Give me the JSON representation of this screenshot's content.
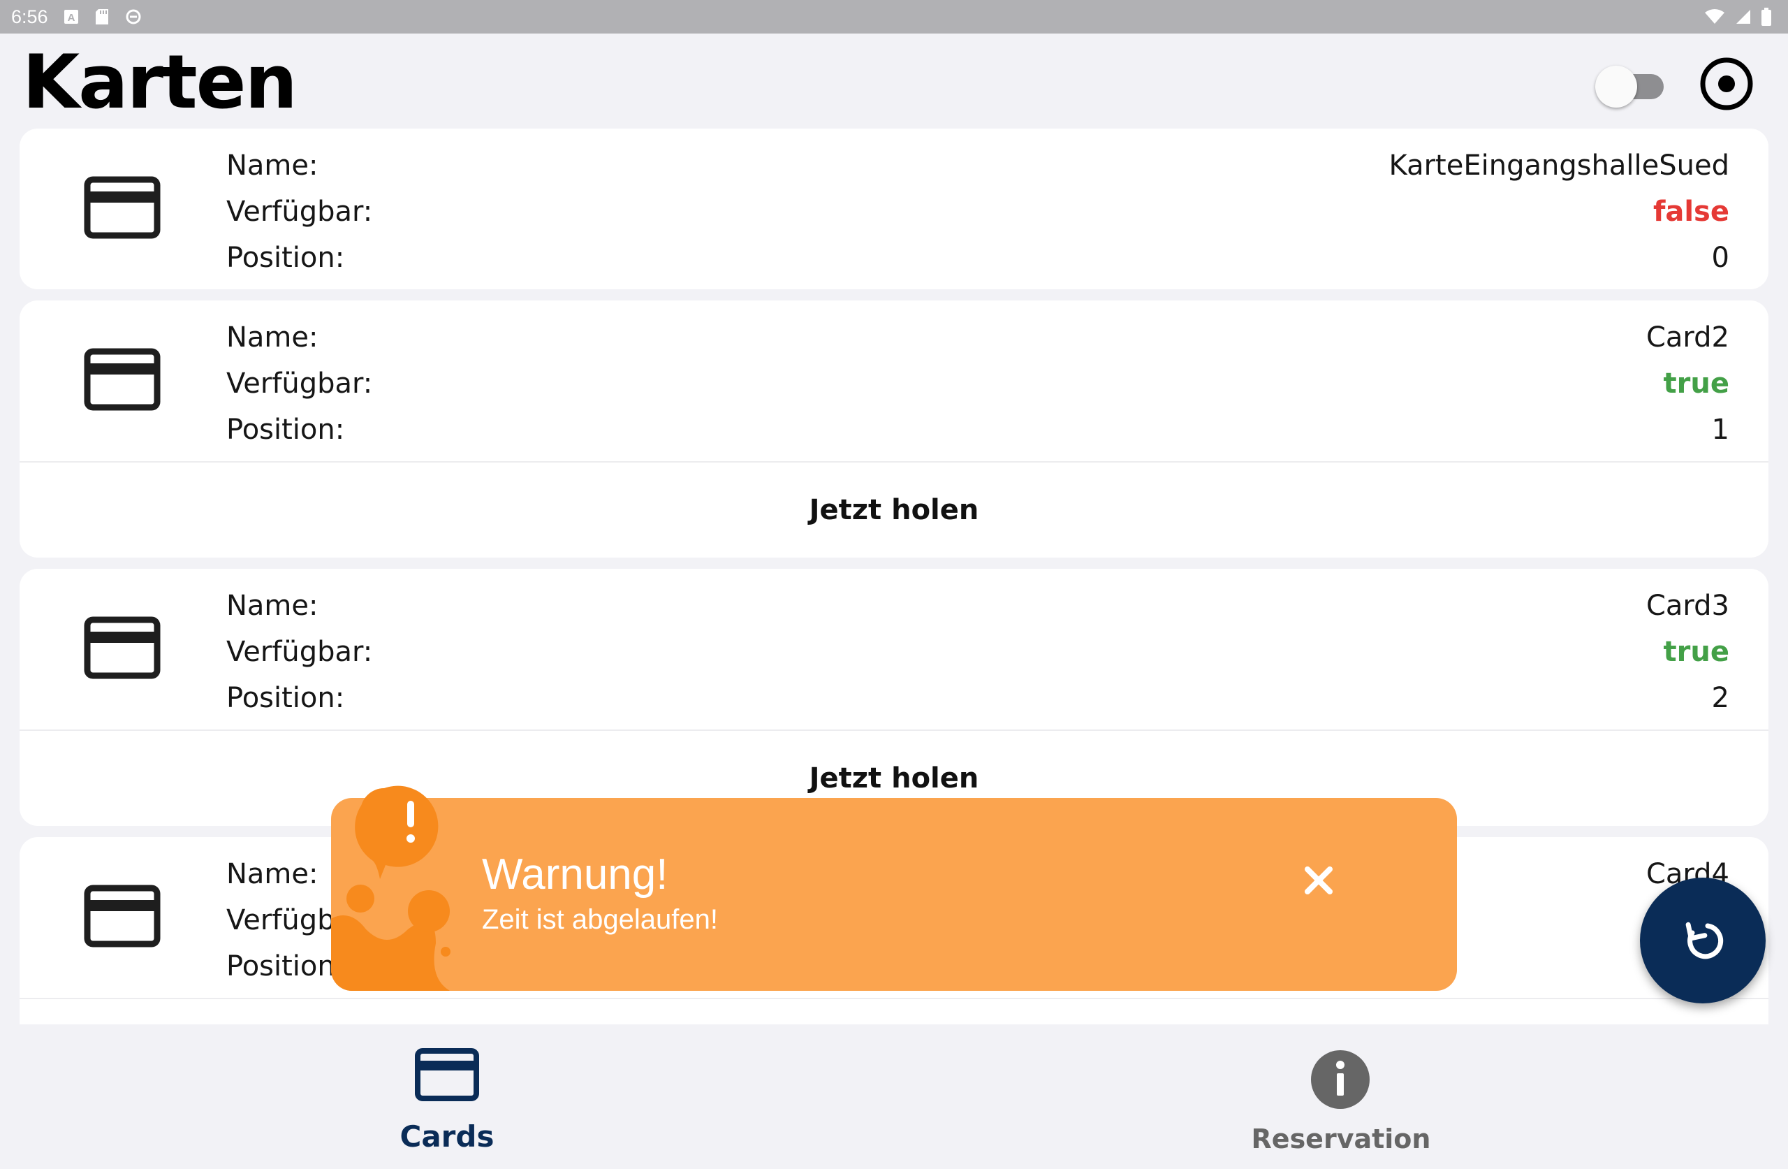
{
  "status_bar": {
    "time": "6:56"
  },
  "header": {
    "title": "Karten"
  },
  "cards": [
    {
      "name_label": "Name:",
      "name": "KarteEingangshalleSued",
      "available_label": "Verfügbar:",
      "available": "false",
      "position_label": "Position:",
      "position": "0",
      "action_label": null
    },
    {
      "name_label": "Name:",
      "name": "Card2",
      "available_label": "Verfügbar:",
      "available": "true",
      "position_label": "Position:",
      "position": "1",
      "action_label": "Jetzt holen"
    },
    {
      "name_label": "Name:",
      "name": "Card3",
      "available_label": "Verfügbar:",
      "available": "true",
      "position_label": "Position:",
      "position": "2",
      "action_label": "Jetzt holen"
    },
    {
      "name_label": "Name:",
      "name": "Card4",
      "available_label": "Verfügbar:",
      "available": "",
      "position_label": "Position:",
      "position": "",
      "action_label": null
    }
  ],
  "toast": {
    "title": "Warnung!",
    "message": "Zeit ist abgelaufen!",
    "color": "#fba44f",
    "accent": "#f78a1d"
  },
  "bottom_nav": {
    "items": [
      {
        "label": "Cards",
        "icon": "credit-card-icon",
        "active": true
      },
      {
        "label": "Reservation",
        "icon": "info-icon",
        "active": false
      }
    ]
  },
  "colors": {
    "accent": "#0a2c57",
    "available_true": "#43a047",
    "available_false": "#e53935"
  },
  "icons": {
    "header_toggle": "toggle-switch",
    "header_action": "radio-target-icon",
    "fab": "refresh-icon"
  }
}
